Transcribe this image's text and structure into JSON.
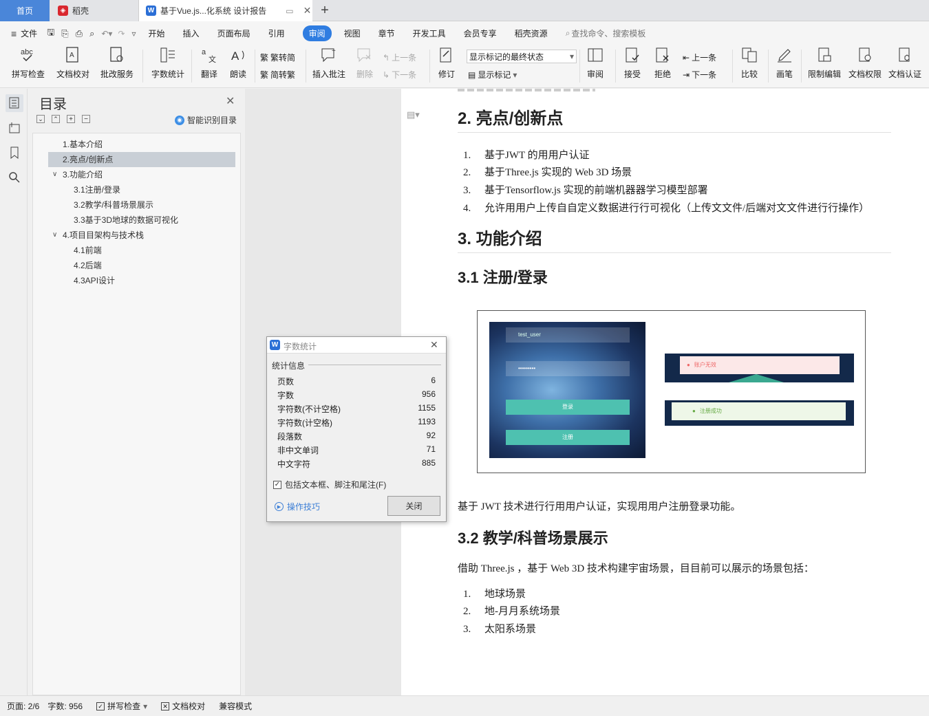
{
  "tabs": {
    "home": "首页",
    "daoke": "稻壳",
    "doc": "基于Vue.js...化系统 设计报告"
  },
  "menu": [
    "文件",
    "开始",
    "插入",
    "页面布局",
    "引用",
    "审阅",
    "视图",
    "章节",
    "开发工具",
    "会员专享",
    "稻壳资源"
  ],
  "menu_active": "审阅",
  "search_placeholder": "查找命令、搜索模板",
  "ribbon": {
    "spell": "拼写检查",
    "proof": "文档校对",
    "correct": "批改服务",
    "wordcount": "字数统计",
    "translate": "翻译",
    "read": "朗读",
    "trad": "繁转简",
    "simp": "简转繁",
    "insert_comment": "插入批注",
    "delete": "删除",
    "prev": "上一条",
    "next": "下一条",
    "track": "修订",
    "markup_state": "显示标记的最终状态",
    "show_markup": "显示标记",
    "review": "审阅",
    "accept": "接受",
    "reject": "拒绝",
    "prev2": "上一条",
    "next2": "下一条",
    "compare": "比较",
    "pen": "画笔",
    "restrict": "限制编辑",
    "perm": "文档权限",
    "cert": "文档认证"
  },
  "toc": {
    "title": "目录",
    "smart": "智能识别目录",
    "items": [
      {
        "label": "1.基本介绍"
      },
      {
        "label": "2.亮点/创新点"
      },
      {
        "label": "3.功能介绍"
      },
      {
        "label": "3.1注册/登录"
      },
      {
        "label": "3.2教学/科普场景展示"
      },
      {
        "label": "3.3基于3D地球的数据可视化"
      },
      {
        "label": "4.项目目架构与技术栈"
      },
      {
        "label": "4.1前端"
      },
      {
        "label": "4.2后端"
      },
      {
        "label": "4.3API设计"
      }
    ]
  },
  "doc": {
    "h_highlights": "2. 亮点/创新点",
    "highlights": [
      "基于JWT 的用用户认证",
      "基于Three.js 实现的 Web 3D 场景",
      "基于Tensorflow.js 实现的前端机器器学习模型部署",
      "允许用用户上传自自定义数据进行行可视化（上传文文件/后端对文文件进行行操作）"
    ],
    "h_features": "3. 功能介绍",
    "h_login": "3.1 注册/登录",
    "fig": {
      "username": "test_user",
      "password": "•••••••••",
      "login_btn": "登录",
      "register_btn": "注册",
      "error_msg": "账户无效",
      "success_msg": "注册成功"
    },
    "login_para": "基于 JWT 技术进行行用用户认证，实现用用户注册登录功能。",
    "h_teach": "3.2 教学/科普场景展示",
    "teach_para": "借助 Three.js ，基于 Web 3D 技术构建宇宙场景，目目前可以展示的场景包括：",
    "scenes": [
      "地球场景",
      "地-月月系统场景",
      "太阳系场景"
    ]
  },
  "dialog": {
    "title": "字数统计",
    "section": "统计信息",
    "rows": [
      {
        "k": "页数",
        "v": "6"
      },
      {
        "k": "字数",
        "v": "956"
      },
      {
        "k": "字符数(不计空格)",
        "v": "1155"
      },
      {
        "k": "字符数(计空格)",
        "v": "1193"
      },
      {
        "k": "段落数",
        "v": "92"
      },
      {
        "k": "非中文单词",
        "v": "71"
      },
      {
        "k": "中文字符",
        "v": "885"
      }
    ],
    "include": "包括文本框、脚注和尾注(F)",
    "tips": "操作技巧",
    "close": "关闭"
  },
  "status": {
    "page": "页面: 2/6",
    "words": "字数: 956",
    "spell": "拼写检查",
    "proof": "文档校对",
    "compat": "兼容模式"
  },
  "colors": {
    "accent": "#2f7de1",
    "tab_home": "#4a86d9",
    "wps_red": "#d9272e"
  }
}
